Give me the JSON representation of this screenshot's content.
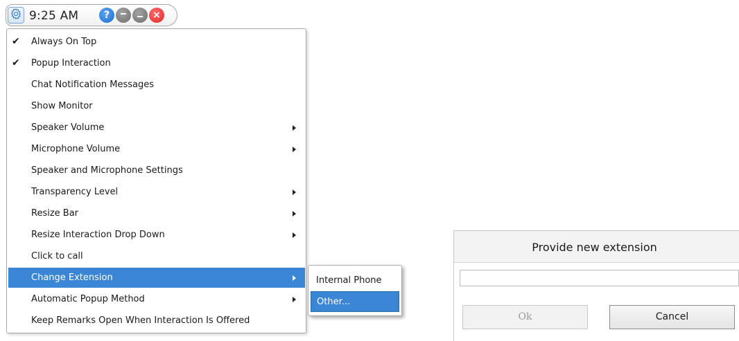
{
  "titlebar": {
    "time": "9:25 AM",
    "settings_icon": "gear-icon",
    "help_icon": "question-icon",
    "help_glyph": "?",
    "minimize_icon": "minimize-icon",
    "restore_icon": "restore-icon",
    "close_icon": "close-icon",
    "close_glyph": "×"
  },
  "menu": {
    "items": [
      {
        "label": "Always On Top",
        "checked": true,
        "check_glyph": "✔",
        "has_submenu": false
      },
      {
        "label": "Popup Interaction",
        "checked": true,
        "check_glyph": "✔",
        "has_submenu": false
      },
      {
        "label": "Chat Notification Messages",
        "checked": false,
        "has_submenu": false
      },
      {
        "label": "Show Monitor",
        "checked": false,
        "has_submenu": false
      },
      {
        "label": "Speaker Volume",
        "checked": false,
        "has_submenu": true
      },
      {
        "label": "Microphone Volume",
        "checked": false,
        "has_submenu": true
      },
      {
        "label": "Speaker and Microphone Settings",
        "checked": false,
        "has_submenu": false
      },
      {
        "label": "Transparency Level",
        "checked": false,
        "has_submenu": true
      },
      {
        "label": "Resize Bar",
        "checked": false,
        "has_submenu": true
      },
      {
        "label": "Resize Interaction Drop Down",
        "checked": false,
        "has_submenu": true
      },
      {
        "label": "Click to call",
        "checked": false,
        "has_submenu": false
      },
      {
        "label": "Change Extension",
        "checked": false,
        "has_submenu": true,
        "highlighted": true
      },
      {
        "label": "Automatic Popup Method",
        "checked": false,
        "has_submenu": true
      },
      {
        "label": "Keep Remarks Open When Interaction Is Offered",
        "checked": false,
        "has_submenu": false
      }
    ]
  },
  "submenu": {
    "items": [
      {
        "label": "Internal Phone",
        "highlighted": false
      },
      {
        "label": "Other...",
        "highlighted": true
      }
    ]
  },
  "dialog": {
    "title": "Provide new extension",
    "input_value": "",
    "ok_label": "Ok",
    "ok_enabled": false,
    "cancel_label": "Cancel"
  },
  "colors": {
    "highlight": "#3a86d4",
    "help_blue": "#1e6fd1",
    "close_red": "#e02424",
    "window_gray": "#6d6d6d"
  }
}
